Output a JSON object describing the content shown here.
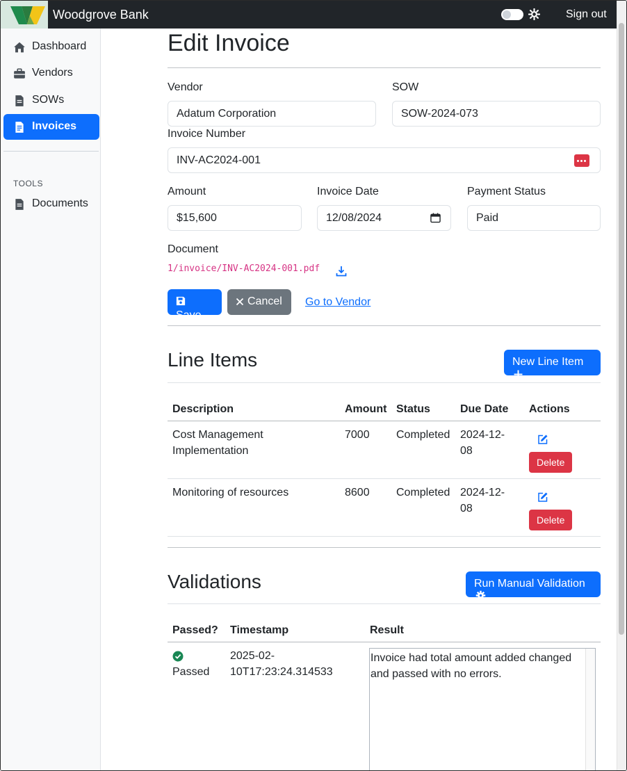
{
  "app": {
    "brand": "Woodgrove Bank",
    "sign_out": "Sign out",
    "colors": {
      "primary": "#0d6efd",
      "danger": "#dc3545",
      "secondary": "#6c757d",
      "success": "#198754",
      "code": "#d63384"
    }
  },
  "sidebar": {
    "items": [
      {
        "label": "Dashboard",
        "icon": "home-icon"
      },
      {
        "label": "Vendors",
        "icon": "briefcase-icon"
      },
      {
        "label": "SOWs",
        "icon": "file-icon"
      },
      {
        "label": "Invoices",
        "icon": "file-text-icon",
        "active": true
      }
    ],
    "tools_label": "TOOLS",
    "tools": [
      {
        "label": "Documents",
        "icon": "file-icon"
      }
    ]
  },
  "page": {
    "title": "Edit Invoice"
  },
  "form": {
    "vendor_label": "Vendor",
    "vendor_value": "Adatum Corporation",
    "sow_label": "SOW",
    "sow_value": "SOW-2024-073",
    "invoice_number_label": "Invoice Number",
    "invoice_number_value": "INV-AC2024-001",
    "amount_label": "Amount",
    "amount_value": "$15,600",
    "invoice_date_label": "Invoice Date",
    "invoice_date_value": "12/08/2024",
    "payment_status_label": "Payment Status",
    "payment_status_value": "Paid",
    "document_label": "Document",
    "document_value": "1/invoice/INV-AC2024-001.pdf",
    "save_label": "Save",
    "cancel_label": "Cancel",
    "go_to_vendor_label": "Go to Vendor"
  },
  "line_items": {
    "title": "Line Items",
    "new_button": "New Line Item",
    "columns": [
      "Description",
      "Amount",
      "Status",
      "Due Date",
      "Actions"
    ],
    "delete_label": "Delete",
    "rows": [
      {
        "description_1": "Cost Management",
        "description_2": "Implementation",
        "amount": "7000",
        "status": "Completed",
        "due_1": "2024-12-",
        "due_2": "08"
      },
      {
        "description_1": "Monitoring of resources",
        "description_2": "",
        "amount": "8600",
        "status": "Completed",
        "due_1": "2024-12-",
        "due_2": "08"
      }
    ]
  },
  "validations": {
    "title": "Validations",
    "run_button": "Run Manual Validation",
    "columns": [
      "Passed?",
      "Timestamp",
      "Result"
    ],
    "rows": [
      {
        "passed": "Passed",
        "timestamp_1": "2025-02-",
        "timestamp_2": "10T17:23:24.314533",
        "result": "Invoice had total amount added changed and passed with no errors."
      }
    ]
  }
}
